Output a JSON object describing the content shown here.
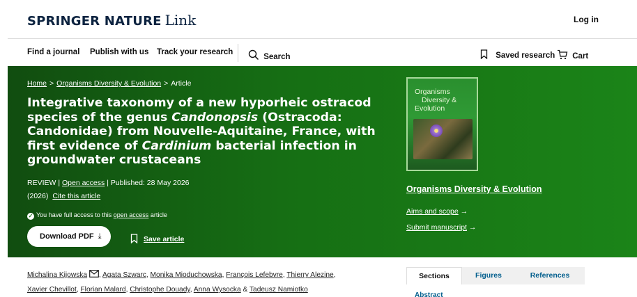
{
  "header": {
    "brand_bold": "SPRINGER NATURE",
    "brand_light": "Link",
    "login": "Log in"
  },
  "nav": {
    "find_journal": "Find a journal",
    "publish": "Publish with us",
    "track": "Track your research",
    "search": "Search",
    "saved": "Saved research",
    "cart": "Cart"
  },
  "breadcrumb": {
    "home": "Home",
    "journal": "Organisms Diversity & Evolution",
    "current": "Article",
    "separator": ">"
  },
  "article": {
    "title_1": "Integrative taxonomy of a new hyporheic ostracod species of the genus ",
    "title_genus": "Candonopsis",
    "title_2": " (Ostracoda: Candonidae) from Nouvelle-Aquitaine, France, with first evidence of ",
    "title_bacterium": "Cardinium",
    "title_3": " bacterial infection in groundwater crustaceans",
    "type": "REVIEW",
    "open_access": "Open access",
    "published": "Published: 28 May 2026",
    "year": "(2026)",
    "cite": "Cite this article",
    "access_prefix": "You have full access to this",
    "access_link": "open access",
    "access_suffix": "article",
    "download": "Download PDF",
    "save": "Save article"
  },
  "journal": {
    "cover_line1": "Organisms",
    "cover_line2": "Diversity &",
    "cover_line3": "Evolution",
    "name": "Organisms Diversity & Evolution",
    "aims": "Aims and scope",
    "submit": "Submit manuscript",
    "arrow": "→"
  },
  "authors": {
    "a1": "Michalina Kijowska",
    "a2": "Agata Szwarc",
    "a3": "Monika Mioduchowska",
    "a4": "François Lefebvre",
    "a5": "Thierry Alezine",
    "a6": "Xavier Chevillot",
    "a7": "Florian Malard",
    "a8": "Christophe Douady",
    "a9": "Anna Wysocka",
    "a10": "Tadeusz Namiotko"
  },
  "sections": {
    "tab1": "Sections",
    "tab2": "Figures",
    "tab3": "References",
    "first": "Abstract"
  },
  "colors": {
    "hero_dark": "#114d10",
    "hero_light": "#1b8418",
    "link_blue": "#025e8d",
    "brand_navy": "#0c2340"
  }
}
